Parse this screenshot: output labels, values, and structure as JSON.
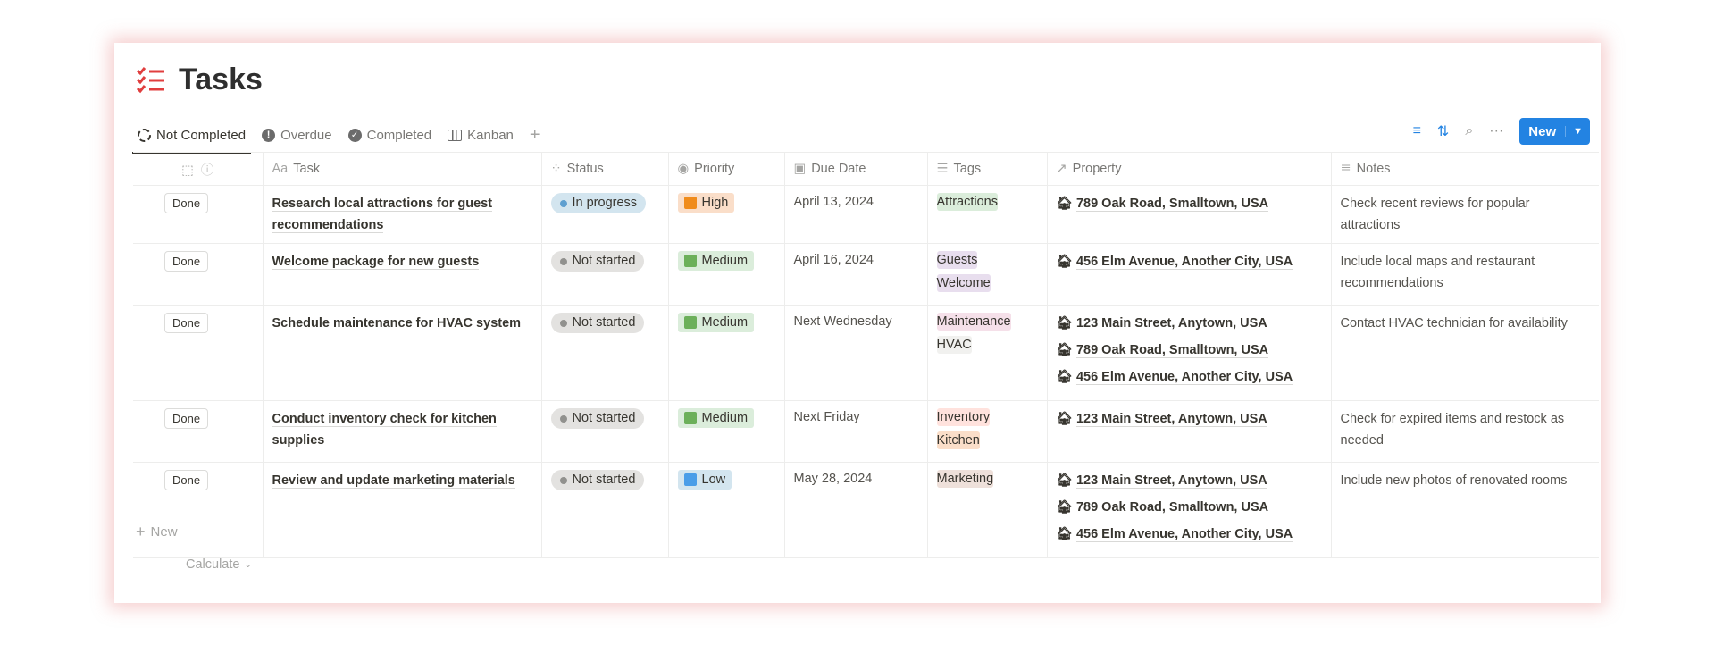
{
  "page": {
    "title": "Tasks",
    "icon": "checklist-icon",
    "accent": "#e03e3e"
  },
  "tabs": [
    {
      "label": "Not Completed",
      "icon": "dashed-circle-icon"
    },
    {
      "label": "Overdue",
      "icon": "alert-circle-icon"
    },
    {
      "label": "Completed",
      "icon": "check-circle-icon"
    },
    {
      "label": "Kanban",
      "icon": "columns-icon"
    }
  ],
  "toolbar": {
    "new_label": "New",
    "brand": "#2383e2"
  },
  "columns": [
    "Task",
    "Status",
    "Priority",
    "Due Date",
    "Tags",
    "Property",
    "Notes"
  ],
  "task_prefix": "Aa",
  "rows": [
    {
      "button": "Done",
      "task": "Research local attractions for guest recommendations",
      "status": "In progress",
      "priority": "High",
      "due": "April 13, 2024",
      "tags": [
        "Attractions"
      ],
      "properties": [
        "789 Oak Road, Smalltown, USA"
      ],
      "notes": "Check recent reviews for popular attractions"
    },
    {
      "button": "Done",
      "task": "Welcome package for new guests",
      "status": "Not started",
      "priority": "Medium",
      "due": "April 16, 2024",
      "tags": [
        "Guests",
        "Welcome"
      ],
      "properties": [
        "456 Elm Avenue, Another City, USA"
      ],
      "notes": "Include local maps and restaurant recommendations"
    },
    {
      "button": "Done",
      "task": "Schedule maintenance for HVAC system",
      "status": "Not started",
      "priority": "Medium",
      "due": "Next Wednesday",
      "tags": [
        "Maintenance",
        "HVAC"
      ],
      "properties": [
        "123 Main Street, Anytown, USA",
        "789 Oak Road, Smalltown, USA",
        "456 Elm Avenue, Another City, USA"
      ],
      "notes": "Contact HVAC technician for availability"
    },
    {
      "button": "Done",
      "task": "Conduct inventory check for kitchen supplies",
      "status": "Not started",
      "priority": "Medium",
      "due": "Next Friday",
      "tags": [
        "Inventory",
        "Kitchen"
      ],
      "properties": [
        "123 Main Street, Anytown, USA"
      ],
      "notes": "Check for expired items and restock as needed"
    },
    {
      "button": "Done",
      "task": "Review and update marketing materials",
      "status": "Not started",
      "priority": "Low",
      "due": "May 28, 2024",
      "tags": [
        "Marketing"
      ],
      "properties": [
        "123 Main Street, Anytown, USA",
        "789 Oak Road, Smalltown, USA",
        "456 Elm Avenue, Another City, USA"
      ],
      "notes": "Include new photos of renovated rooms"
    }
  ],
  "status_colors": {
    "In progress": {
      "bg": "#d3e5ef",
      "dot": "#5e9fd0"
    },
    "Not started": {
      "bg": "#e3e2e0",
      "dot": "#91918e"
    }
  },
  "priority_colors": {
    "High": {
      "bg": "#fadec9",
      "sq": "#f08c1c"
    },
    "Medium": {
      "bg": "#dbeddb",
      "sq": "#6cb05a"
    },
    "Low": {
      "bg": "#d3e5ef",
      "sq": "#4a9de8"
    }
  },
  "tag_colors": {
    "Attractions": "#dbeddb",
    "Guests": "#e8deee",
    "Welcome": "#e8deee",
    "Maintenance": "#f5e0e9",
    "HVAC": "#f1f1ef",
    "Inventory": "#ffe2dd",
    "Kitchen": "#fadec9",
    "Marketing": "#eee0da"
  },
  "footer": {
    "new_label": "New",
    "calculate_label": "Calculate"
  }
}
